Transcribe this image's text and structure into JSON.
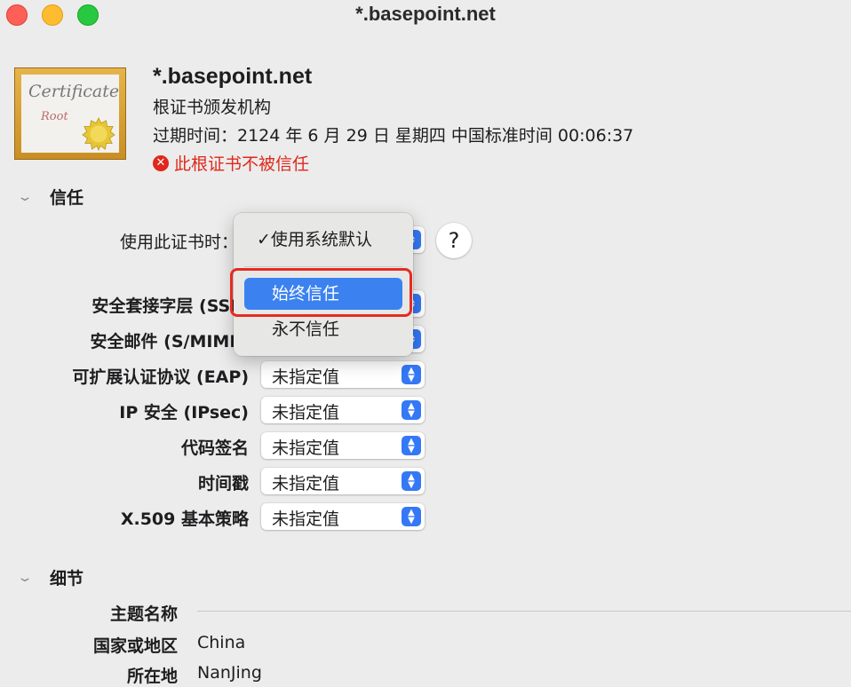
{
  "window": {
    "title": "*.basepoint.net"
  },
  "header": {
    "cert_icon_text": "Certificate",
    "cert_icon_subtext": "Root",
    "name": "*.basepoint.net",
    "issuer_line": "根证书颁发机构",
    "expiry_line": "过期时间：2124 年 6 月 29 日 星期四 中国标准时间 00:06:37",
    "status": "此根证书不被信任",
    "status_color": "#e0281b"
  },
  "trust": {
    "section_title": "信任",
    "when_using_label": "使用此证书时：",
    "help_label": "?",
    "rows": [
      {
        "label": "安全套接字层 (SSL)",
        "value": ""
      },
      {
        "label": "安全邮件 (S/MIME)",
        "value": ""
      },
      {
        "label": "可扩展认证协议 (EAP)",
        "value": "未指定值"
      },
      {
        "label": "IP 安全 (IPsec)",
        "value": "未指定值"
      },
      {
        "label": "代码签名",
        "value": "未指定值"
      },
      {
        "label": "时间戳",
        "value": "未指定值"
      },
      {
        "label": "X.509 基本策略",
        "value": "未指定值"
      }
    ]
  },
  "menu": {
    "items": [
      {
        "label": "使用系统默认",
        "checkmark": "✓"
      },
      {
        "label": "始终信任",
        "highlighted": true
      },
      {
        "label": "永不信任"
      }
    ],
    "highlight_color": "#3b82f0",
    "annotation_color": "#e52b21"
  },
  "details": {
    "section_title": "细节",
    "rows": [
      {
        "label": "主题名称",
        "value": ""
      },
      {
        "label": "国家或地区",
        "value": "China"
      },
      {
        "label": "所在地",
        "value": "NanJing"
      }
    ]
  }
}
